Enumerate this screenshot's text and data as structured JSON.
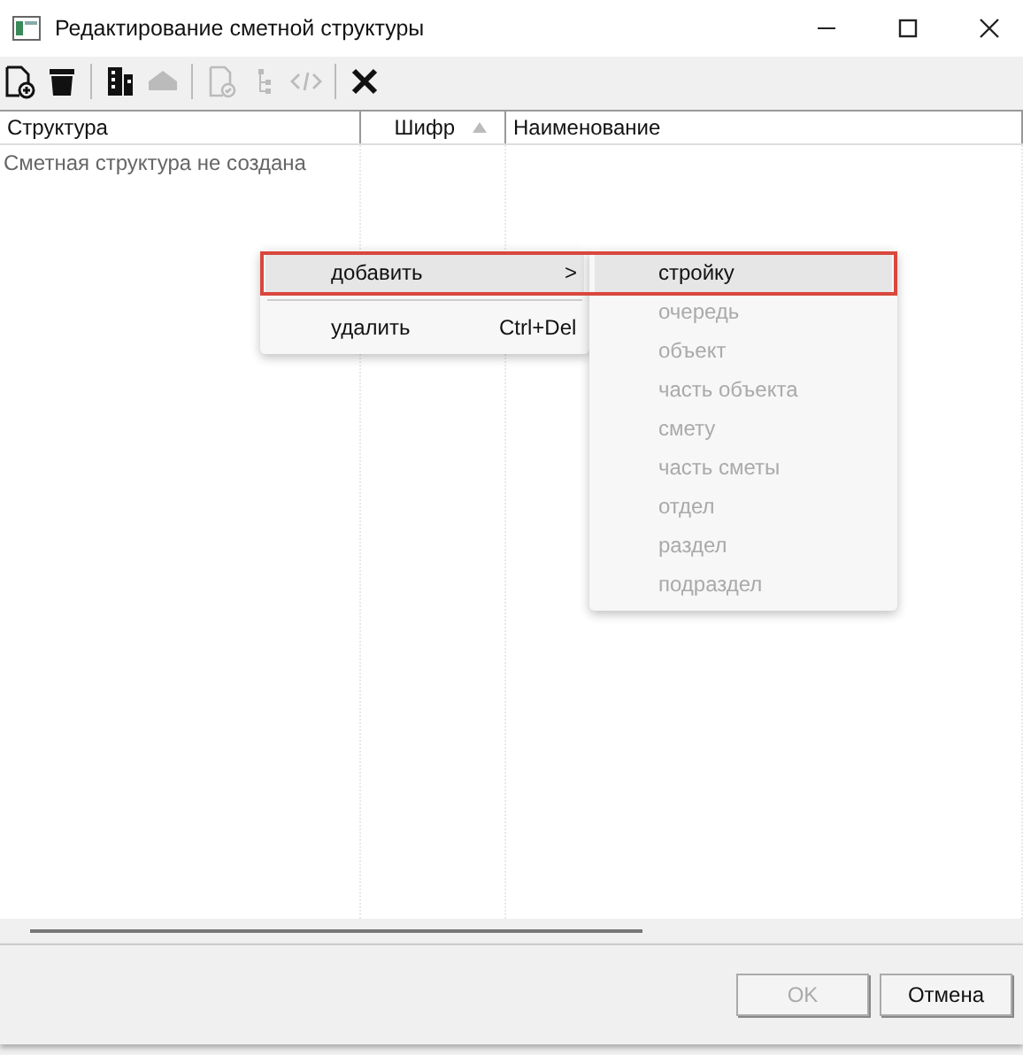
{
  "window": {
    "title": "Редактирование сметной структуры"
  },
  "toolbar": [
    {
      "kind": "new-doc",
      "disabled": false
    },
    {
      "kind": "trash",
      "disabled": false
    },
    {
      "kind": "separator"
    },
    {
      "kind": "building",
      "disabled": false
    },
    {
      "kind": "house",
      "disabled": true
    },
    {
      "kind": "separator"
    },
    {
      "kind": "doc-check",
      "disabled": true
    },
    {
      "kind": "tree",
      "disabled": true
    },
    {
      "kind": "code",
      "disabled": true
    },
    {
      "kind": "separator"
    },
    {
      "kind": "close",
      "disabled": false
    }
  ],
  "table": {
    "columns": [
      {
        "label": "Структура",
        "sorted": false
      },
      {
        "label": "Шифр",
        "sorted": true
      },
      {
        "label": "Наименование",
        "sorted": false
      }
    ],
    "empty_message": "Сметная структура не создана"
  },
  "context_menu": {
    "items": [
      {
        "kind": "item",
        "label": "добавить",
        "arrow": ">",
        "selected": true
      },
      {
        "kind": "separator"
      },
      {
        "kind": "item",
        "label": "удалить",
        "shortcut": "Ctrl+Del",
        "selected": false
      }
    ]
  },
  "submenu": {
    "items": [
      {
        "label": "стройку",
        "disabled": false,
        "selected": true
      },
      {
        "label": "очередь",
        "disabled": true,
        "selected": false
      },
      {
        "label": "объект",
        "disabled": true,
        "selected": false
      },
      {
        "label": "часть объекта",
        "disabled": true,
        "selected": false
      },
      {
        "label": "смету",
        "disabled": true,
        "selected": false
      },
      {
        "label": "часть сметы",
        "disabled": true,
        "selected": false
      },
      {
        "label": "отдел",
        "disabled": true,
        "selected": false
      },
      {
        "label": "раздел",
        "disabled": true,
        "selected": false
      },
      {
        "label": "подраздел",
        "disabled": true,
        "selected": false
      }
    ]
  },
  "buttons": [
    {
      "label": "OK",
      "disabled": true
    },
    {
      "label": "Отмена",
      "disabled": false
    }
  ]
}
